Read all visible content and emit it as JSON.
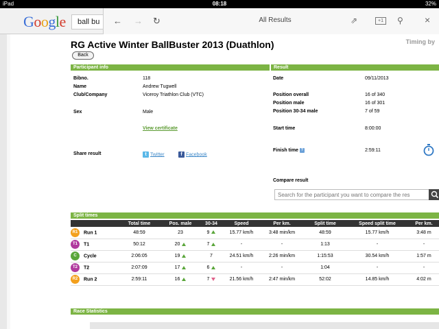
{
  "status_bar": {
    "device": "iPad",
    "time": "08:18",
    "battery": "32%"
  },
  "browser": {
    "logo": {
      "letters": [
        "G",
        "o",
        "o",
        "g",
        "l",
        "e"
      ]
    },
    "search_query": "ball bu",
    "panel_title": "All Results",
    "back_icon": "arrow-left-icon",
    "forward_icon": "arrow-right-icon",
    "reload_icon": "reload-icon",
    "share_icon": "share-icon",
    "tab_icon": "tab-icon",
    "tab_label": "+1",
    "find_icon": "find-icon",
    "close_icon": "close-icon"
  },
  "page": {
    "timing_label": "Timing by",
    "title": "RG Active Winter BallBuster 2013 (Duathlon)",
    "back_label": "Back"
  },
  "participant": {
    "header": "Participant info",
    "bibno_label": "Bibno.",
    "bibno": "118",
    "name_label": "Name",
    "name": "Andrew Tugwell",
    "club_label": "Club/Company",
    "club": "Viceroy Triathlon Club (VTC)",
    "sex_label": "Sex",
    "sex": "Male",
    "certificate_link": "View certificate",
    "share_label": "Share result",
    "twitter": "Twitter",
    "facebook": "Facebook"
  },
  "result": {
    "header": "Result",
    "date_label": "Date",
    "date": "09/11/2013",
    "pos_overall_label": "Position overall",
    "pos_overall": "16 of 340",
    "pos_male_label": "Position male",
    "pos_male": "16 of 301",
    "pos_age_label": "Position 30-34 male",
    "pos_age": "7 of 59",
    "start_label": "Start time",
    "start": "8:00:00",
    "finish_label": "Finish time",
    "finish": "2:59:11",
    "compare_label": "Compare result",
    "compare_placeholder": "Search for the participant you want to compare the res"
  },
  "splits": {
    "header": "Split times",
    "columns": [
      "",
      "Total time",
      "Pos. male",
      "30-34",
      "Speed",
      "Per km.",
      "Split time",
      "Speed split time",
      "Per km."
    ],
    "rows": [
      {
        "icon": "R1",
        "kind": "run",
        "leg": "Run 1",
        "total": "48:59",
        "pos_male": "23",
        "pos_male_trend": "",
        "age": "9",
        "age_trend": "up",
        "speed": "15.77 km/h",
        "per_km": "3:48 min/km",
        "split": "48:59",
        "split_speed": "15.77 km/h",
        "split_per_km": "3:48 m"
      },
      {
        "icon": "T1",
        "kind": "t",
        "leg": "T1",
        "total": "50:12",
        "pos_male": "20",
        "pos_male_trend": "up",
        "age": "7",
        "age_trend": "up",
        "speed": "-",
        "per_km": "-",
        "split": "1:13",
        "split_speed": "-",
        "split_per_km": "-"
      },
      {
        "icon": "C",
        "kind": "cyc",
        "leg": "Cycle",
        "total": "2:06:05",
        "pos_male": "19",
        "pos_male_trend": "up",
        "age": "7",
        "age_trend": "",
        "speed": "24.51 km/h",
        "per_km": "2:26 min/km",
        "split": "1:15:53",
        "split_speed": "30.54 km/h",
        "split_per_km": "1:57 m"
      },
      {
        "icon": "T2",
        "kind": "t",
        "leg": "T2",
        "total": "2:07:09",
        "pos_male": "17",
        "pos_male_trend": "up",
        "age": "6",
        "age_trend": "up",
        "speed": "-",
        "per_km": "-",
        "split": "1:04",
        "split_speed": "-",
        "split_per_km": "-"
      },
      {
        "icon": "R2",
        "kind": "run",
        "leg": "Run 2",
        "total": "2:59:11",
        "pos_male": "16",
        "pos_male_trend": "up",
        "age": "7",
        "age_trend": "down",
        "speed": "21.56 km/h",
        "per_km": "2:47 min/km",
        "split": "52:02",
        "split_speed": "14.85 km/h",
        "split_per_km": "4:02 m"
      }
    ]
  },
  "race_statistics_header": "Race Statistics",
  "colors": {
    "accent_green": "#7cb444",
    "table_header": "#333333",
    "link_blue": "#3d88c8"
  }
}
